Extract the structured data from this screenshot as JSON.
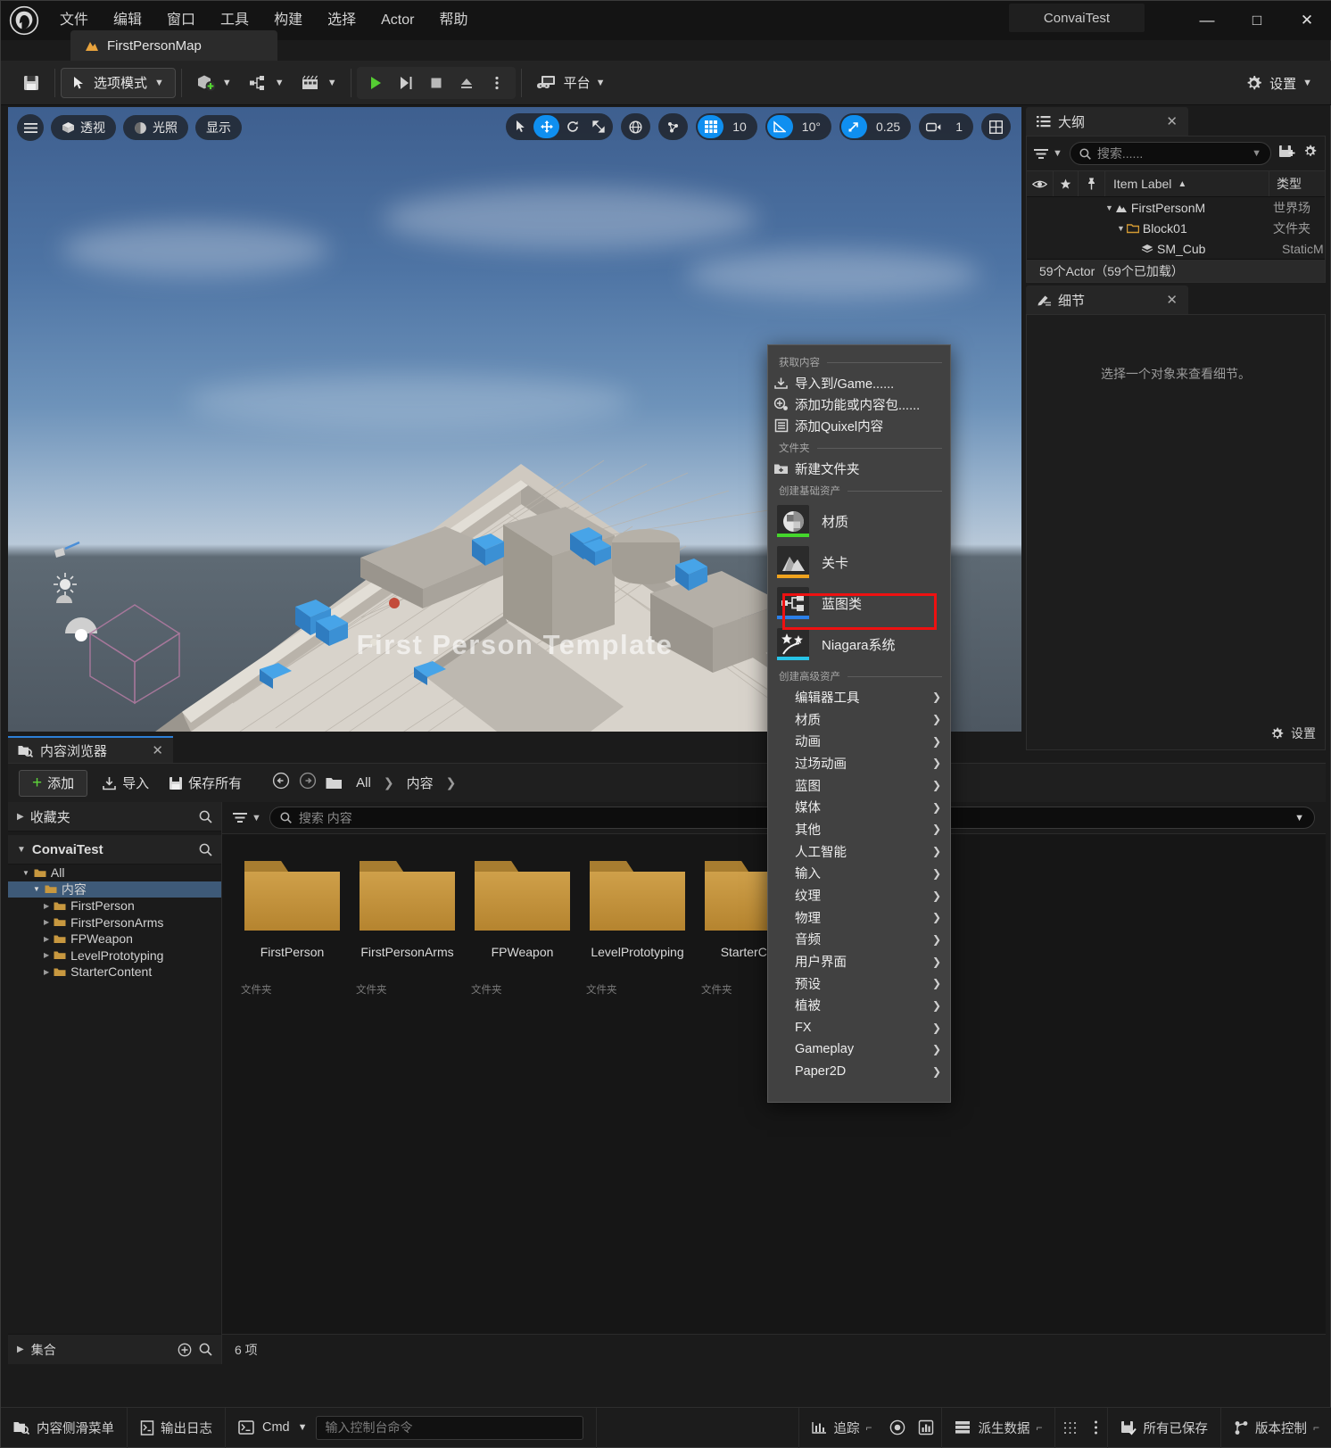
{
  "window": {
    "title": "ConvaiTest",
    "minimize": "—",
    "maximize": "□",
    "close": "✕"
  },
  "menubar": {
    "items": [
      "文件",
      "编辑",
      "窗口",
      "工具",
      "构建",
      "选择",
      "Actor",
      "帮助"
    ]
  },
  "tab": {
    "label": "FirstPersonMap"
  },
  "toolbar": {
    "save_tooltip": "保存",
    "mode_label": "选项模式",
    "platform_label": "平台",
    "settings_label": "设置"
  },
  "viewport": {
    "menu_icon": "hamburger-icon",
    "perspective": "透视",
    "lighting": "光照",
    "show": "显示",
    "grid_value": "10",
    "angle_value": "10°",
    "scale_value": "0.25",
    "camera_value": "1",
    "overlay_text": "First Person Template"
  },
  "outliner": {
    "tab_label": "大纲",
    "close": "✕",
    "search_placeholder": "搜索......",
    "columns": [
      "Item Label",
      "类型"
    ],
    "sort_arrow": "▲",
    "rows": [
      {
        "label": "FirstPersonM",
        "type": "世界场",
        "depth": 0,
        "icon": "level-icon"
      },
      {
        "label": "Block01",
        "type": "文件夹",
        "depth": 1,
        "icon": "folder-icon"
      },
      {
        "label": "SM_Cub",
        "type": "StaticM",
        "depth": 2,
        "icon": "mesh-icon"
      }
    ],
    "count_text": "59个Actor（59个已加载）"
  },
  "details": {
    "tab_label": "细节",
    "close": "✕",
    "empty_message": "选择一个对象来查看细节。",
    "settings_label": "设置"
  },
  "content_browser": {
    "tab_label": "内容浏览器",
    "close": "✕",
    "add_label": "添加",
    "import_label": "导入",
    "save_all_label": "保存所有",
    "breadcrumbs": [
      "All",
      "内容"
    ],
    "favorites_label": "收藏夹",
    "project_label": "ConvaiTest",
    "tree": [
      {
        "label": "All",
        "depth": 0,
        "expanded": true,
        "selected": false
      },
      {
        "label": "内容",
        "depth": 1,
        "expanded": true,
        "selected": true
      },
      {
        "label": "FirstPerson",
        "depth": 2,
        "expanded": false,
        "selected": false
      },
      {
        "label": "FirstPersonArms",
        "depth": 2,
        "expanded": false,
        "selected": false
      },
      {
        "label": "FPWeapon",
        "depth": 2,
        "expanded": false,
        "selected": false
      },
      {
        "label": "LevelPrototyping",
        "depth": 2,
        "expanded": false,
        "selected": false
      },
      {
        "label": "StarterContent",
        "depth": 2,
        "expanded": false,
        "selected": false
      }
    ],
    "search_placeholder": "搜索 内容",
    "folders": [
      {
        "name": "FirstPerson",
        "type": "文件夹"
      },
      {
        "name": "FirstPersonArms",
        "type": "文件夹"
      },
      {
        "name": "FPWeapon",
        "type": "文件夹"
      },
      {
        "name": "LevelPrototyping",
        "type": "文件夹"
      },
      {
        "name": "StarterCont",
        "type": "文件夹"
      }
    ],
    "item_count": "6 项",
    "collections_label": "集合"
  },
  "context_menu": {
    "sections": [
      {
        "title": "获取内容"
      },
      {
        "title": "文件夹"
      },
      {
        "title": "创建基础资产"
      },
      {
        "title": "创建高级资产"
      }
    ],
    "get_content_items": [
      {
        "label": "导入到/Game......",
        "icon": "import-icon"
      },
      {
        "label": "添加功能或内容包......",
        "icon": "add-feature-icon"
      },
      {
        "label": "添加Quixel内容",
        "icon": "quixel-icon"
      }
    ],
    "folder_items": [
      {
        "label": "新建文件夹",
        "icon": "new-folder-icon"
      }
    ],
    "basic_assets": [
      {
        "label": "材质",
        "icon": "material-icon",
        "accent": "#44d62c"
      },
      {
        "label": "关卡",
        "icon": "level-icon",
        "accent": "#f0a31e"
      },
      {
        "label": "蓝图类",
        "icon": "blueprint-icon",
        "accent": "#2b7fe8",
        "highlighted": true
      },
      {
        "label": "Niagara系统",
        "icon": "niagara-icon",
        "accent": "#27c3e6"
      }
    ],
    "advanced_assets": [
      "编辑器工具",
      "材质",
      "动画",
      "过场动画",
      "蓝图",
      "媒体",
      "其他",
      "人工智能",
      "输入",
      "纹理",
      "物理",
      "音频",
      "用户界面",
      "预设",
      "植被",
      "FX",
      "Gameplay",
      "Paper2D"
    ],
    "submenu_arrow": "❯",
    "highlight_color": "#ee1111"
  },
  "status_bar": {
    "content_drawer": "内容侧滑菜单",
    "output_log": "输出日志",
    "cmd_label": "Cmd",
    "cmd_placeholder": "输入控制台命令",
    "trace": "追踪",
    "derived_data": "派生数据",
    "all_saved": "所有已保存",
    "source_control": "版本控制"
  },
  "colors": {
    "accent_blue": "#0f8ff0",
    "folder": "#c8983f",
    "highlight_red": "#ee1111",
    "panel_bg": "#1d1d1d"
  }
}
